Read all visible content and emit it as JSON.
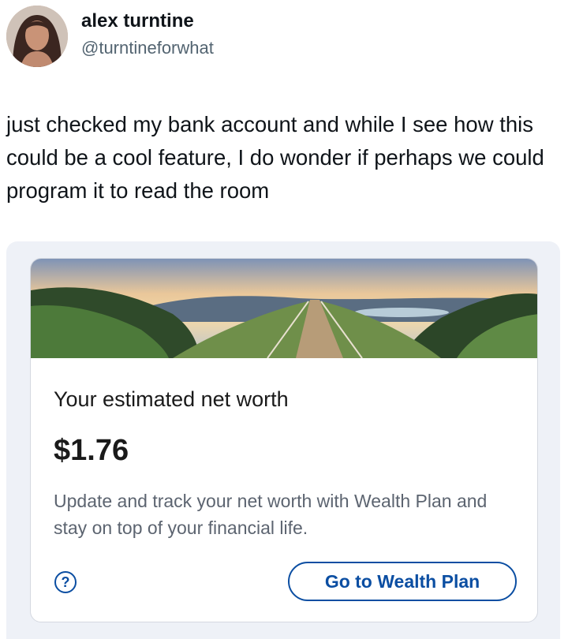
{
  "tweet": {
    "display_name": "alex turntine",
    "handle": "@turntineforwhat",
    "text": "just checked my bank account and while I see how this could be a cool feature, I do wonder if perhaps we could program it to read the room"
  },
  "card": {
    "banner": "landscape-path-photo",
    "title": "Your estimated net worth",
    "amount": "$1.76",
    "description": "Update and track your net worth with Wealth Plan and stay on top of your financial life.",
    "help_icon": "question-circle-icon",
    "button_label": "Go to Wealth Plan",
    "accent_color": "#0b4ea2"
  }
}
